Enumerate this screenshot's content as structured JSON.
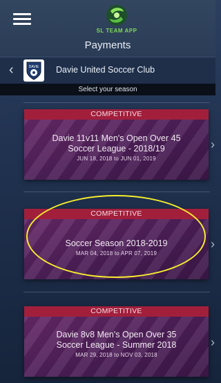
{
  "header": {
    "title": "Payments",
    "logo_text": "SL TEAM APP",
    "menu_icon": "hamburger-menu-icon",
    "logo_icon": "stteamapp-logo-icon"
  },
  "club": {
    "name": "Davie United Soccer Club",
    "logo_text": "DAVIE",
    "back_icon": "chevron-left-icon"
  },
  "season_prompt": "Select your season",
  "seasons": [
    {
      "type": "COMPETITIVE",
      "title_line1": "Davie 11v11 Men's Open Over 45",
      "title_line2": "Soccer League - 2018/19",
      "dates": "JUN 18, 2018 to JUN 01, 2019"
    },
    {
      "type": "COMPETITIVE",
      "title_line1": "Soccer Season 2018-2019",
      "title_line2": "",
      "dates": "MAR 04, 2018 to APR 07, 2019",
      "highlighted": true
    },
    {
      "type": "COMPETITIVE",
      "title_line1": "Davie 8v8 Men's Open Over 35",
      "title_line2": "Soccer League - Summer 2018",
      "dates": "MAR 29, 2018 to NOV 03, 2018"
    }
  ],
  "colors": {
    "competitive_badge": "#a21f3c",
    "card_bg": "#5a2463",
    "highlight": "#f7ee2e",
    "logo_green": "#7ed957"
  }
}
